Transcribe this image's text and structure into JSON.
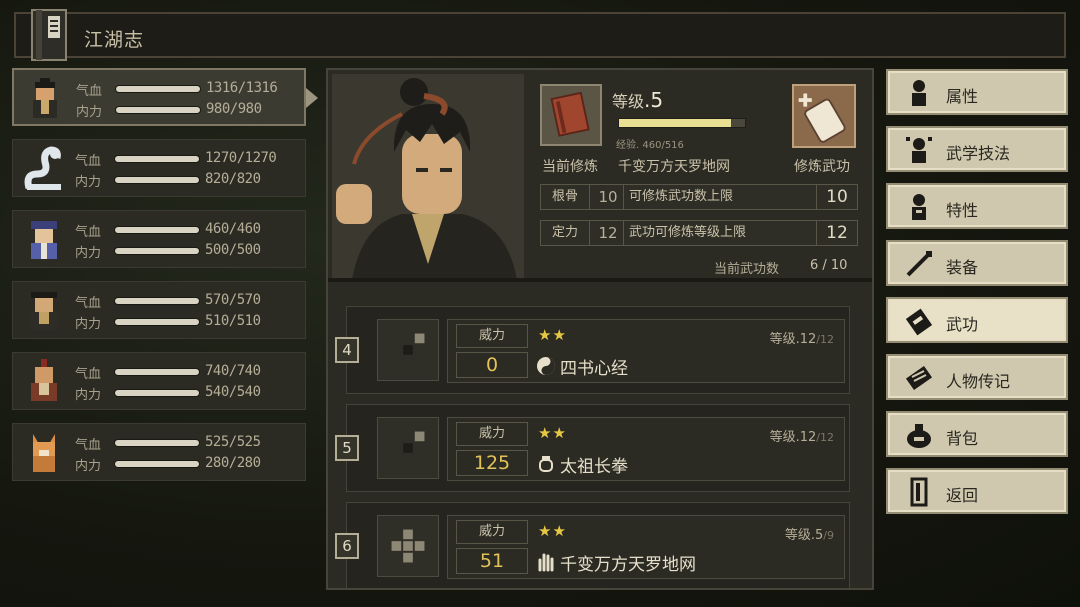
{
  "header": {
    "title": "江湖志"
  },
  "characters": [
    {
      "hp_label": "气血",
      "mp_label": "内力",
      "hp": "1316/1316",
      "mp": "980/980",
      "selected": true
    },
    {
      "hp_label": "气血",
      "mp_label": "内力",
      "hp": "1270/1270",
      "mp": "820/820"
    },
    {
      "hp_label": "气血",
      "mp_label": "内力",
      "hp": "460/460",
      "mp": "500/500"
    },
    {
      "hp_label": "气血",
      "mp_label": "内力",
      "hp": "570/570",
      "mp": "510/510"
    },
    {
      "hp_label": "气血",
      "mp_label": "内力",
      "hp": "740/740",
      "mp": "540/540"
    },
    {
      "hp_label": "气血",
      "mp_label": "内力",
      "hp": "525/525",
      "mp": "280/280"
    }
  ],
  "detail": {
    "rank_prefix": "等级",
    "rank_value": ".5",
    "xp_text": "经验. 460/516",
    "xp_fraction": 0.89,
    "current_label": "当前修炼",
    "current_name": "千变万方天罗地网",
    "practice_label": "修炼武功",
    "stats": [
      {
        "tag": "根骨",
        "value": "10",
        "desc": "可修炼武功数上限",
        "limit": "10"
      },
      {
        "tag": "定力",
        "value": "12",
        "desc": "武功可修炼等级上限",
        "limit": "12"
      }
    ],
    "count_label": "当前武功数",
    "count_value": "6 / 10"
  },
  "skills": [
    {
      "slot": "4",
      "power_label": "威力",
      "power": "0",
      "stars": "★★",
      "level": "等级.12",
      "level_max": "/12",
      "name": "四书心经",
      "icon": "yin-yang-icon"
    },
    {
      "slot": "5",
      "power_label": "威力",
      "power": "125",
      "stars": "★★",
      "level": "等级.12",
      "level_max": "/12",
      "name": "太祖长拳",
      "icon": "fist-icon"
    },
    {
      "slot": "6",
      "power_label": "威力",
      "power": "51",
      "stars": "★★",
      "level": "等级.5",
      "level_max": "/9",
      "name": "千变万方天罗地网",
      "icon": "palm-icon"
    }
  ],
  "menu": [
    {
      "label": "属性",
      "icon": "person-icon"
    },
    {
      "label": "武学技法",
      "icon": "technique-icon"
    },
    {
      "label": "特性",
      "icon": "trait-icon"
    },
    {
      "label": "装备",
      "icon": "sword-icon"
    },
    {
      "label": "武功",
      "icon": "book-icon",
      "active": true
    },
    {
      "label": "人物传记",
      "icon": "scroll-icon"
    },
    {
      "label": "背包",
      "icon": "bag-icon"
    },
    {
      "label": "返回",
      "icon": "door-icon"
    }
  ],
  "colors": {
    "accent_gold": "#e3c25a",
    "star": "#e7c845",
    "xp_bar": "#e9df93",
    "menu_bg": "#cfc8ae"
  }
}
